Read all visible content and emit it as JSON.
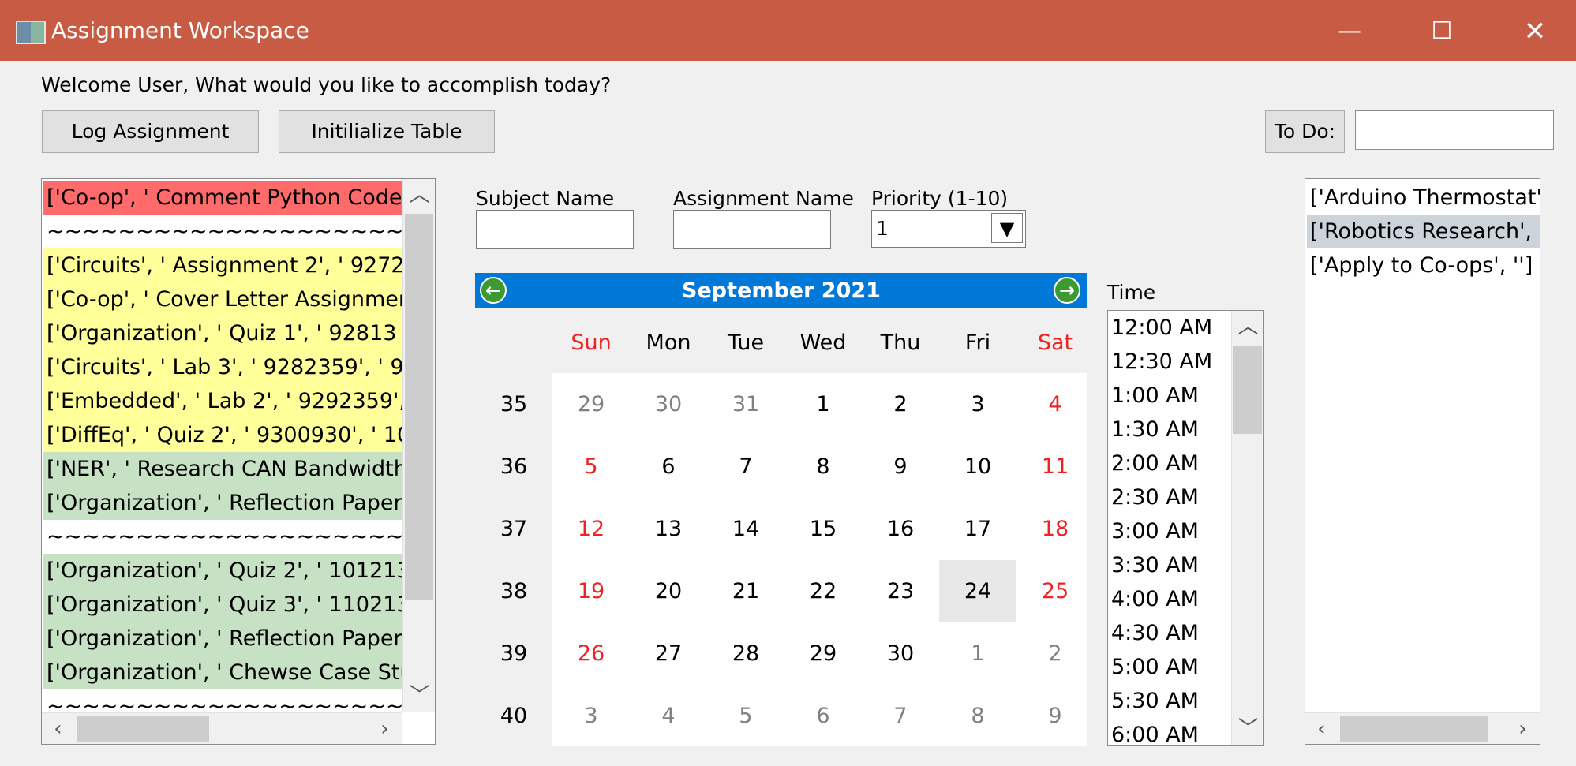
{
  "window": {
    "title": "Assignment Workspace",
    "minimize_glyph": "—",
    "maximize_glyph": "☐",
    "close_glyph": "✕"
  },
  "welcome": "Welcome User, What would you like to accomplish today?",
  "buttons": {
    "log": "Log Assignment",
    "init": "Initilialize Table"
  },
  "todo": {
    "label": "To Do:",
    "value": ""
  },
  "assignments_list": [
    {
      "text": "['Co-op', '  Comment Python Code",
      "color": "red"
    },
    {
      "text": "~~~~~~~~~~~~~~~~~~~~~~~~",
      "color": "white"
    },
    {
      "text": "['Circuits', '  Assignment 2', '  9272",
      "color": "yellow"
    },
    {
      "text": "['Co-op', '  Cover Letter Assignmen",
      "color": "yellow"
    },
    {
      "text": "['Organization', '  Quiz 1', '  92813",
      "color": "yellow"
    },
    {
      "text": "['Circuits', '  Lab 3', '  9282359', '  9",
      "color": "yellow"
    },
    {
      "text": "['Embedded', '  Lab 2', '  9292359', ",
      "color": "yellow"
    },
    {
      "text": "['DiffEq', '  Quiz 2', '  9300930', '  10",
      "color": "yellow"
    },
    {
      "text": "['NER', '  Research CAN Bandwidth",
      "color": "green"
    },
    {
      "text": "['Organization', '  Reflection Paper",
      "color": "green"
    },
    {
      "text": "~~~~~~~~~~~~~~~~~~~~~~~~",
      "color": "white"
    },
    {
      "text": "['Organization', '  Quiz 2', '  101213",
      "color": "green"
    },
    {
      "text": "['Organization', '  Quiz 3', '  110213",
      "color": "green"
    },
    {
      "text": "['Organization', '  Reflection Paper",
      "color": "green"
    },
    {
      "text": "['Organization', '  Chewse Case Stu",
      "color": "green"
    },
    {
      "text": "~~~~~~~~~~~~~~~~~~~~~~~~",
      "color": "white"
    }
  ],
  "form": {
    "subject_label": "Subject Name",
    "subject_value": "",
    "assignment_label": "Assignment Name",
    "assignment_value": "",
    "priority_label": "Priority (1-10)",
    "priority_value": "1"
  },
  "calendar": {
    "month_year": "September  2021",
    "day_headers": [
      "Sun",
      "Mon",
      "Tue",
      "Wed",
      "Thu",
      "Fri",
      "Sat"
    ],
    "selected_day": "24",
    "weeks": [
      {
        "num": "35",
        "days": [
          "29",
          "30",
          "31",
          "1",
          "2",
          "3",
          "4"
        ]
      },
      {
        "num": "36",
        "days": [
          "5",
          "6",
          "7",
          "8",
          "9",
          "10",
          "11"
        ]
      },
      {
        "num": "37",
        "days": [
          "12",
          "13",
          "14",
          "15",
          "16",
          "17",
          "18"
        ]
      },
      {
        "num": "38",
        "days": [
          "19",
          "20",
          "21",
          "22",
          "23",
          "24",
          "25"
        ]
      },
      {
        "num": "39",
        "days": [
          "26",
          "27",
          "28",
          "29",
          "30",
          "1",
          "2"
        ]
      },
      {
        "num": "40",
        "days": [
          "3",
          "4",
          "5",
          "6",
          "7",
          "8",
          "9"
        ]
      }
    ]
  },
  "time": {
    "label": "Time",
    "options": [
      "12:00 AM",
      "12:30 AM",
      "1:00 AM",
      "1:30 AM",
      "2:00 AM",
      "2:30 AM",
      "3:00 AM",
      "3:30 AM",
      "4:00 AM",
      "4:30 AM",
      "5:00 AM",
      "5:30 AM",
      "6:00 AM"
    ]
  },
  "todo_list": [
    {
      "text": "['Arduino Thermostat', ''",
      "selected": false
    },
    {
      "text": "['Robotics Research', ''",
      "selected": true
    },
    {
      "text": "['Apply to Co-ops', '']",
      "selected": false
    }
  ],
  "colors": {
    "titlebar": "#c85b44",
    "calendar_nav": "#0078d7",
    "weekend": "#ee2222",
    "row_red": "#ff6b6b",
    "row_yellow": "#ffff99",
    "row_green": "#c6e1c4"
  }
}
